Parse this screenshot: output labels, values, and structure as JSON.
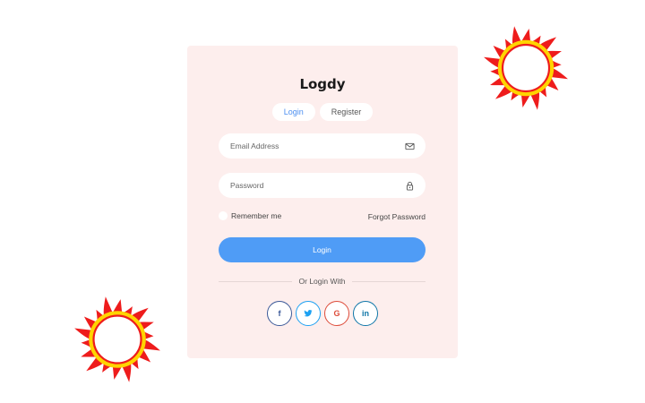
{
  "brand": {
    "name": "Logdy"
  },
  "tabs": [
    {
      "label": "Login",
      "active": true
    },
    {
      "label": "Register",
      "active": false
    }
  ],
  "form": {
    "email_placeholder": "Email Address",
    "password_placeholder": "Password",
    "remember_label": "Remember me",
    "forgot_label": "Forgot Password",
    "submit_label": "Login"
  },
  "divider": {
    "text": "Or Login With"
  },
  "social": [
    {
      "name": "facebook",
      "glyph": "f",
      "color": "#3b5998",
      "icon": "facebook-icon"
    },
    {
      "name": "twitter",
      "glyph": "🐦",
      "color": "#1da1f2",
      "icon": "twitter-icon"
    },
    {
      "name": "google",
      "glyph": "G",
      "color": "#dd4b39",
      "icon": "google-icon"
    },
    {
      "name": "linkedin",
      "glyph": "in",
      "color": "#0e76a8",
      "icon": "linkedin-icon"
    }
  ],
  "colors": {
    "card_bg": "#fdeeed",
    "accent": "#4f9cf6",
    "tab_active_text": "#4c8ff0",
    "sun_flame": "#ee1c1c",
    "sun_ring": "#ffd400"
  }
}
